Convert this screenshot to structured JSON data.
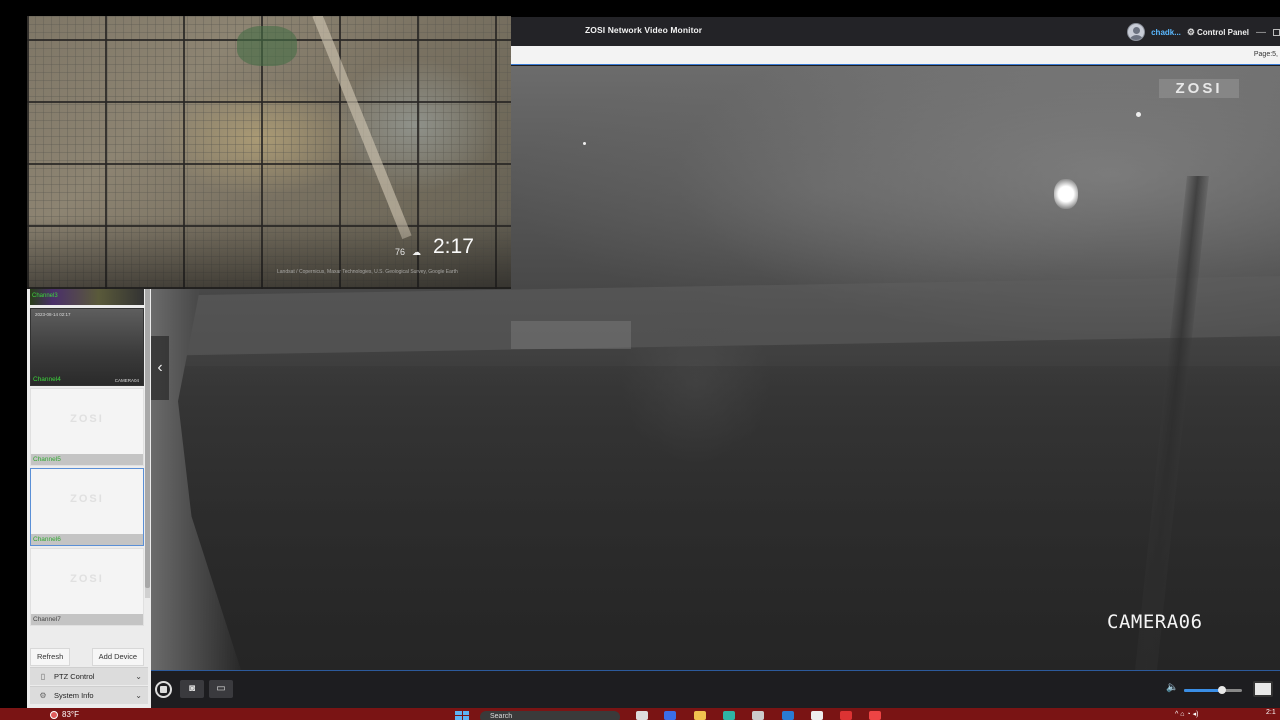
{
  "app": {
    "title": "ZOSI Network Video Monitor",
    "username": "chadk...",
    "control_panel": "Control Panel",
    "page_label": "Page:5,"
  },
  "video": {
    "watermark": "ZOSI",
    "camera_label": "CAMERA06"
  },
  "sidebar": {
    "stub_label": "Channel3",
    "channels": [
      {
        "label": "Channel4",
        "type": "live",
        "timestamp": "2023-08-14 02:17",
        "name": "CAMERA04",
        "selected": false
      },
      {
        "label": "Channel5",
        "type": "empty",
        "watermark": "ZOSI",
        "selected": false,
        "label_color": "#2fa82f"
      },
      {
        "label": "Channel6",
        "type": "empty",
        "watermark": "ZOSI",
        "selected": true,
        "label_color": "#2fa82f"
      },
      {
        "label": "Channel7",
        "type": "empty",
        "watermark": "ZOSI",
        "selected": false,
        "label_color": "#444444"
      }
    ],
    "refresh_label": "Refresh",
    "add_device_label": "Add Device",
    "ptz_label": "PTZ Control",
    "system_info_label": "System Info"
  },
  "toolbar": {
    "volume_level": 0.65
  },
  "map_overlay": {
    "temperature": "76",
    "time": "2:17",
    "credit": "Landsat / Copernicus, Maxar Technologies, U.S. Geological Survey, Google Earth"
  },
  "taskbar": {
    "weather": "83°F",
    "search_placeholder": "Search",
    "clock": "2:1"
  },
  "colors": {
    "accent": "#3a8ee6",
    "taskbar": "#7a1414",
    "username": "#5ab8ff",
    "channel_active": "#2fa82f"
  }
}
